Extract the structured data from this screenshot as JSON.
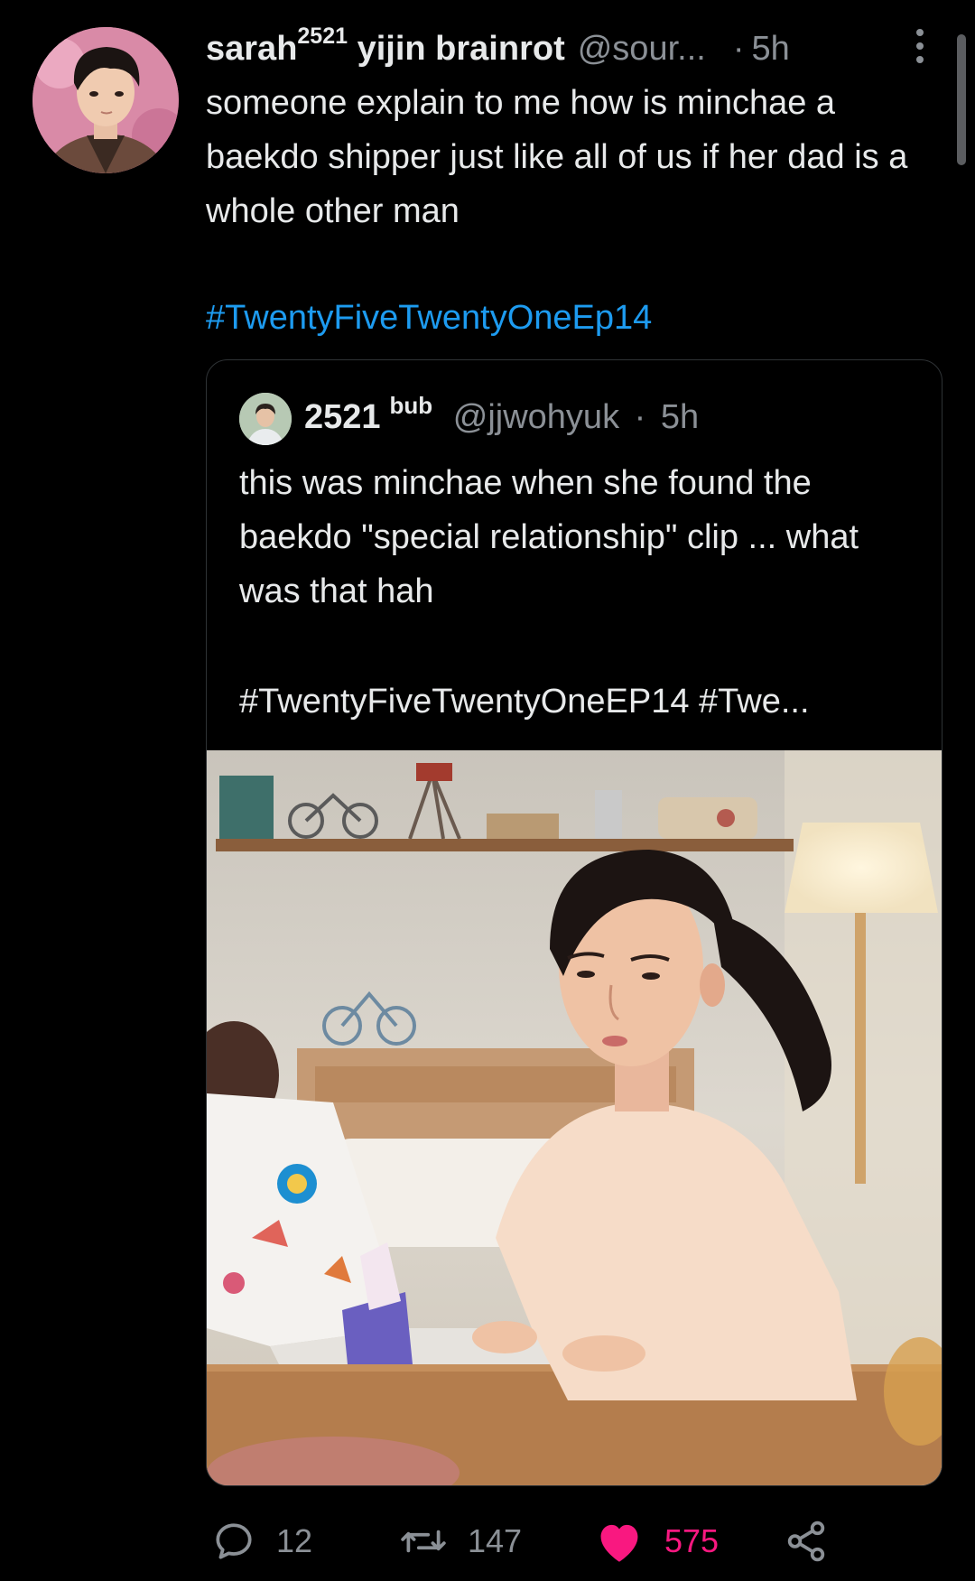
{
  "tweet": {
    "display_name": "sarah",
    "display_name_sup": "2521",
    "display_name_suffix": "yijin brainrot",
    "handle": "@sour...",
    "dot": "·",
    "time": "5h",
    "text": "someone explain to me how is minchae a baekdo shipper just like all of us if her dad is a whole other man",
    "hashtag": "#TwentyFiveTwentyOneEp14"
  },
  "quote": {
    "name": "2521",
    "name_sup": "bub",
    "handle": "@jjwohyuk",
    "dot": "·",
    "time": "5h",
    "text": "this was minchae when she found the baekdo \"special relationship\" clip ... what was that hah",
    "hashtags": "#TwentyFiveTwentyOneEP14 #Twe..."
  },
  "actions": {
    "replies": "12",
    "retweets": "147",
    "likes": "575"
  },
  "icons": {
    "reply": "reply-icon",
    "retweet": "retweet-icon",
    "like": "heart-icon",
    "share": "share-icon",
    "more": "more-vertical-icon"
  },
  "colors": {
    "background": "#000000",
    "text": "#e7e9ea",
    "secondary": "#8b9096",
    "link": "#1d9bf0",
    "like": "#f91880"
  }
}
